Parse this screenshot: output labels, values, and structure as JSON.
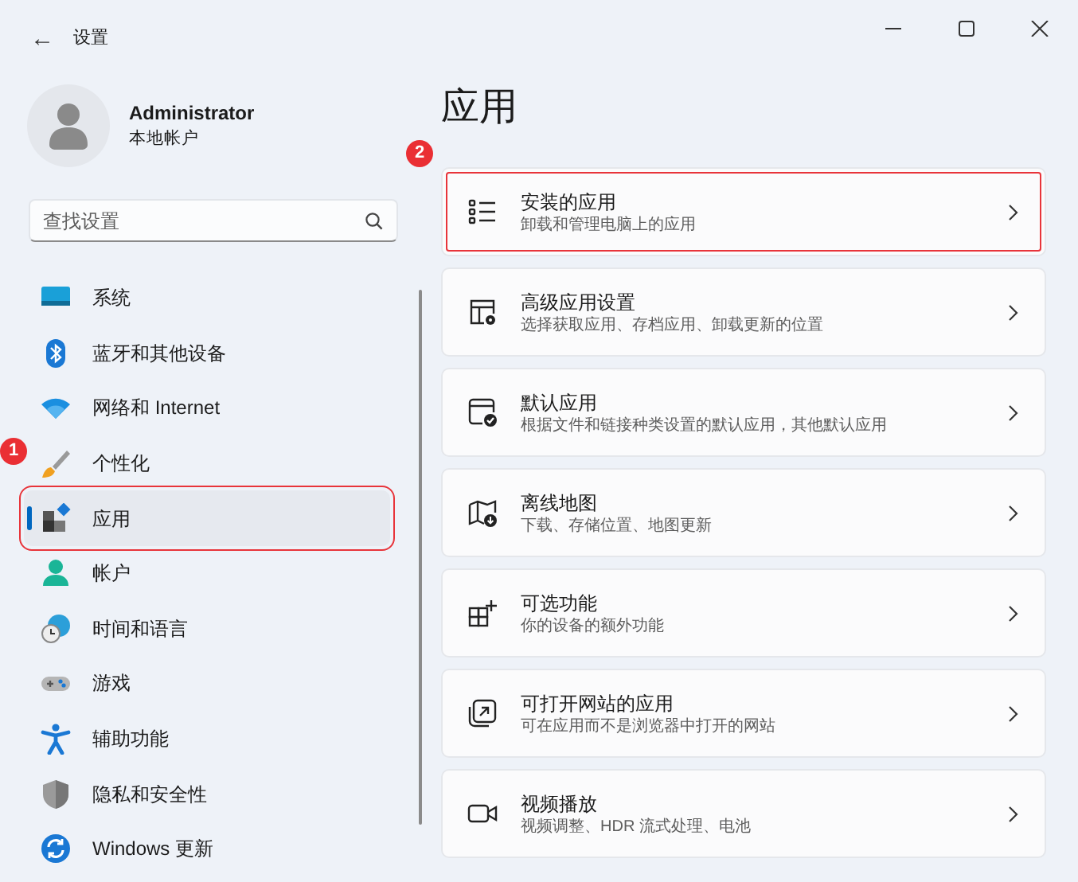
{
  "window": {
    "back": "←",
    "title": "设置"
  },
  "profile": {
    "name": "Administrator",
    "account": "本地帐户"
  },
  "search": {
    "placeholder": "查找设置"
  },
  "nav": [
    {
      "label": "系统",
      "selected": false,
      "outlined": false
    },
    {
      "label": "蓝牙和其他设备",
      "selected": false,
      "outlined": false
    },
    {
      "label": "网络和 Internet",
      "selected": false,
      "outlined": false
    },
    {
      "label": "个性化",
      "selected": false,
      "outlined": false,
      "callout": "1"
    },
    {
      "label": "应用",
      "selected": true,
      "outlined": true
    },
    {
      "label": "帐户",
      "selected": false,
      "outlined": false
    },
    {
      "label": "时间和语言",
      "selected": false,
      "outlined": false
    },
    {
      "label": "游戏",
      "selected": false,
      "outlined": false
    },
    {
      "label": "辅助功能",
      "selected": false,
      "outlined": false
    },
    {
      "label": "隐私和安全性",
      "selected": false,
      "outlined": false
    },
    {
      "label": "Windows 更新",
      "selected": false,
      "outlined": false
    }
  ],
  "page": {
    "title": "应用"
  },
  "cards": [
    {
      "title": "安装的应用",
      "subtitle": "卸载和管理电脑上的应用",
      "outlined": true,
      "callout": "2"
    },
    {
      "title": "高级应用设置",
      "subtitle": "选择获取应用、存档应用、卸载更新的位置",
      "outlined": false
    },
    {
      "title": "默认应用",
      "subtitle": "根据文件和链接种类设置的默认应用，其他默认应用",
      "outlined": false
    },
    {
      "title": "离线地图",
      "subtitle": "下载、存储位置、地图更新",
      "outlined": false
    },
    {
      "title": "可选功能",
      "subtitle": "你的设备的额外功能",
      "outlined": false
    },
    {
      "title": "可打开网站的应用",
      "subtitle": "可在应用而不是浏览器中打开的网站",
      "outlined": false
    },
    {
      "title": "视频播放",
      "subtitle": "视频调整、HDR 流式处理、电池",
      "outlined": false
    }
  ]
}
